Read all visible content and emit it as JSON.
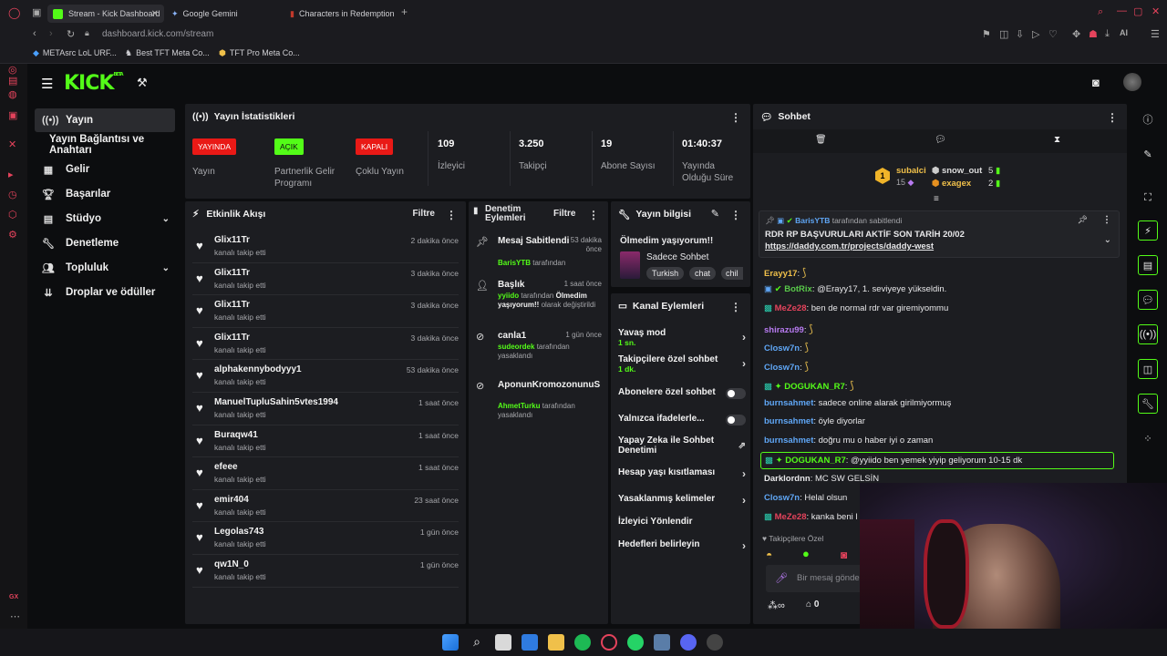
{
  "browser": {
    "tabs": [
      {
        "label": "Stream - Kick Dashboard",
        "active": true
      },
      {
        "label": "Google Gemini",
        "active": false
      },
      {
        "label": "Characters in Redemption",
        "active": false
      }
    ],
    "url_host": "dashboard.kick.com",
    "url_path": "/stream",
    "bookmarks": [
      "METAsrc LoL URF...",
      "Best TFT Meta Co...",
      "TFT Pro Meta Co..."
    ],
    "ai_label": "AI",
    "sidebar_bottom_label": "GX"
  },
  "app": {
    "logo": "KICK",
    "logo_beta": "BETA",
    "nav": [
      {
        "label": "Yayın",
        "icon": "broadcast-icon",
        "active": true
      },
      {
        "label": "Yayın Bağlantısı ve Anahtarı",
        "icon": "",
        "active": false
      },
      {
        "label": "Gelir",
        "icon": "revenue-icon",
        "active": false
      },
      {
        "label": "Başarılar",
        "icon": "trophy-icon",
        "active": false
      },
      {
        "label": "Stüdyo",
        "icon": "studio-icon",
        "active": false,
        "expandable": true
      },
      {
        "label": "Denetleme",
        "icon": "wrench-icon",
        "active": false
      },
      {
        "label": "Topluluk",
        "icon": "community-icon",
        "active": false,
        "expandable": true
      },
      {
        "label": "Droplar ve ödüller",
        "icon": "drops-icon",
        "active": false
      }
    ]
  },
  "stats": {
    "title": "Yayın İstatistikleri",
    "items": [
      {
        "badge": "YAYINDA",
        "badge_color": "#e91916",
        "label": "Yayın"
      },
      {
        "badge": "AÇIK",
        "badge_color": "#53fc18",
        "label": "Partnerlik Gelir Programı"
      },
      {
        "badge": "KAPALI",
        "badge_color": "#e91916",
        "label": "Çoklu Yayın"
      },
      {
        "value": "109",
        "label": "İzleyici"
      },
      {
        "value": "3.250",
        "label": "Takipçi"
      },
      {
        "value": "19",
        "label": "Abone Sayısı"
      },
      {
        "value": "01:40:37",
        "label": "Yayında Olduğu Süre"
      }
    ]
  },
  "activity": {
    "title": "Etkinlik Akışı",
    "filter": "Filtre",
    "items": [
      {
        "name": "Glix11Tr",
        "sub": "kanalı takip etti",
        "time": "2 dakika önce"
      },
      {
        "name": "Glix11Tr",
        "sub": "kanalı takip etti",
        "time": "3 dakika önce"
      },
      {
        "name": "Glix11Tr",
        "sub": "kanalı takip etti",
        "time": "3 dakika önce"
      },
      {
        "name": "Glix11Tr",
        "sub": "kanalı takip etti",
        "time": "3 dakika önce"
      },
      {
        "name": "alphakennybodyyy1",
        "sub": "kanalı takip etti",
        "time": "53 dakika önce"
      },
      {
        "name": "ManuelTupluSahin5vtes1994",
        "sub": "kanalı takip etti",
        "time": "1 saat önce"
      },
      {
        "name": "Buraqw41",
        "sub": "kanalı takip etti",
        "time": "1 saat önce"
      },
      {
        "name": "efeee",
        "sub": "kanalı takip etti",
        "time": "1 saat önce"
      },
      {
        "name": "emir404",
        "sub": "kanalı takip etti",
        "time": "23 saat önce"
      },
      {
        "name": "Legolas743",
        "sub": "kanalı takip etti",
        "time": "1 gün önce"
      },
      {
        "name": "qw1N_0",
        "sub": "kanalı takip etti",
        "time": "1 gün önce"
      }
    ]
  },
  "moderation": {
    "title_line1": "Denetim",
    "title_line2": "Eylemleri",
    "filter": "Filtre",
    "items": [
      {
        "title": "Mesaj Sabitlendi",
        "time": "53 dakika önce",
        "actor": "BarisYTB",
        "desc": " tarafından"
      },
      {
        "title": "Başlık",
        "time": "1 saat önce",
        "actor": "yyiido",
        "desc": " tarafından ",
        "bold": "Ölmedim yaşıyorum!!",
        "desc2": " olarak değiştirildi"
      },
      {
        "title": "canla1",
        "time": "1 gün önce",
        "actor": "sudeordek",
        "desc": " tarafından yasaklandı"
      },
      {
        "title": "AponunKromozonunuSik",
        "time": "",
        "actor": "AhmetTurku",
        "desc": " tarafından yasaklandı"
      }
    ]
  },
  "stream_info": {
    "title": "Yayın bilgisi",
    "stream_title": "Ölmedim yaşıyorum!!",
    "category": "Sadece Sohbet",
    "tags": [
      "Turkish",
      "chat",
      "chil"
    ]
  },
  "channel_actions": {
    "title": "Kanal Eylemleri",
    "items": [
      {
        "label": "Yavaş mod",
        "sub": "1 sn.",
        "control": "chevron"
      },
      {
        "label": "Takipçilere özel sohbet",
        "sub": "1 dk.",
        "control": "chevron"
      },
      {
        "label": "Abonelere özel sohbet",
        "sub": "",
        "control": "toggle"
      },
      {
        "label": "Yalnızca ifadelerle...",
        "sub": "",
        "control": "toggle"
      },
      {
        "label": "Yapay Zeka ile Sohbet Denetimi",
        "sub": "",
        "control": "external"
      },
      {
        "label": "Hesap yaşı kısıtlaması",
        "sub": "",
        "control": "chevron"
      },
      {
        "label": "Yasaklanmış kelimeler",
        "sub": "",
        "control": "chevron"
      },
      {
        "label": "İzleyici Yönlendir",
        "sub": "",
        "control": "none"
      },
      {
        "label": "Hedefleri belirleyin",
        "sub": "",
        "control": "chevron"
      }
    ]
  },
  "chat": {
    "title": "Sohbet",
    "leaderboard": [
      {
        "rank": "1",
        "name": "subalci",
        "count": "15"
      },
      {
        "name": "snow_out",
        "count": "5"
      },
      {
        "name": "exagex",
        "count": "2"
      }
    ],
    "pinned": {
      "by_user": "BarisYTB",
      "by_text": " tarafından sabitlendi",
      "text": "RDR RP BAŞVURULARI AKTİF SON TARİH 20/02",
      "link": "https://daddy.com.tr/projects/daddy-west"
    },
    "messages": [
      {
        "user": "Erayy17",
        "color": "#f0c04a",
        "text": ":"
      },
      {
        "user": "BotRix",
        "color": "#59c94a",
        "text": ": @Erayy17, 1. seviyeye yükseldin."
      },
      {
        "user": "MeZe28",
        "color": "#e5435c",
        "text": ": ben de normal rdr var giremiyommu"
      },
      {
        "user": "shirazu99",
        "color": "#b77af0",
        "text": ":"
      },
      {
        "user": "Closw7n",
        "color": "#5fa6f5",
        "text": ":"
      },
      {
        "user": "Closw7n",
        "color": "#5fa6f5",
        "text": ":"
      },
      {
        "user": "DOGUKAN_R7",
        "color": "#53fc18",
        "text": ":"
      },
      {
        "user": "burnsahmet",
        "color": "#5fa6f5",
        "text": ": sadece online alarak girilmiyormuş"
      },
      {
        "user": "burnsahmet",
        "color": "#5fa6f5",
        "text": ": öyle diyorlar"
      },
      {
        "user": "burnsahmet",
        "color": "#5fa6f5",
        "text": ": doğru mu o haber iyi o zaman"
      },
      {
        "user": "DOGUKAN_R7",
        "color": "#53fc18",
        "text": ": @yyiido ben yemek yiyip geliyorum 10-15 dk"
      },
      {
        "user": "Darklordnn",
        "color": "#e8e8ea",
        "text": ": MC SW GELSİN"
      },
      {
        "user": "Closw7n",
        "color": "#5fa6f5",
        "text": ": Helal olsun"
      },
      {
        "user": "MeZe28",
        "color": "#e5435c",
        "text": ": kanka beni l"
      }
    ],
    "followers_only": "Takipçilere Özel",
    "input_placeholder": "Bir mesaj gönde",
    "points": "0"
  },
  "colors": {
    "accent": "#53fc18",
    "live_red": "#e91916",
    "panel": "#1c1d21",
    "bg": "#0c0d0f"
  }
}
